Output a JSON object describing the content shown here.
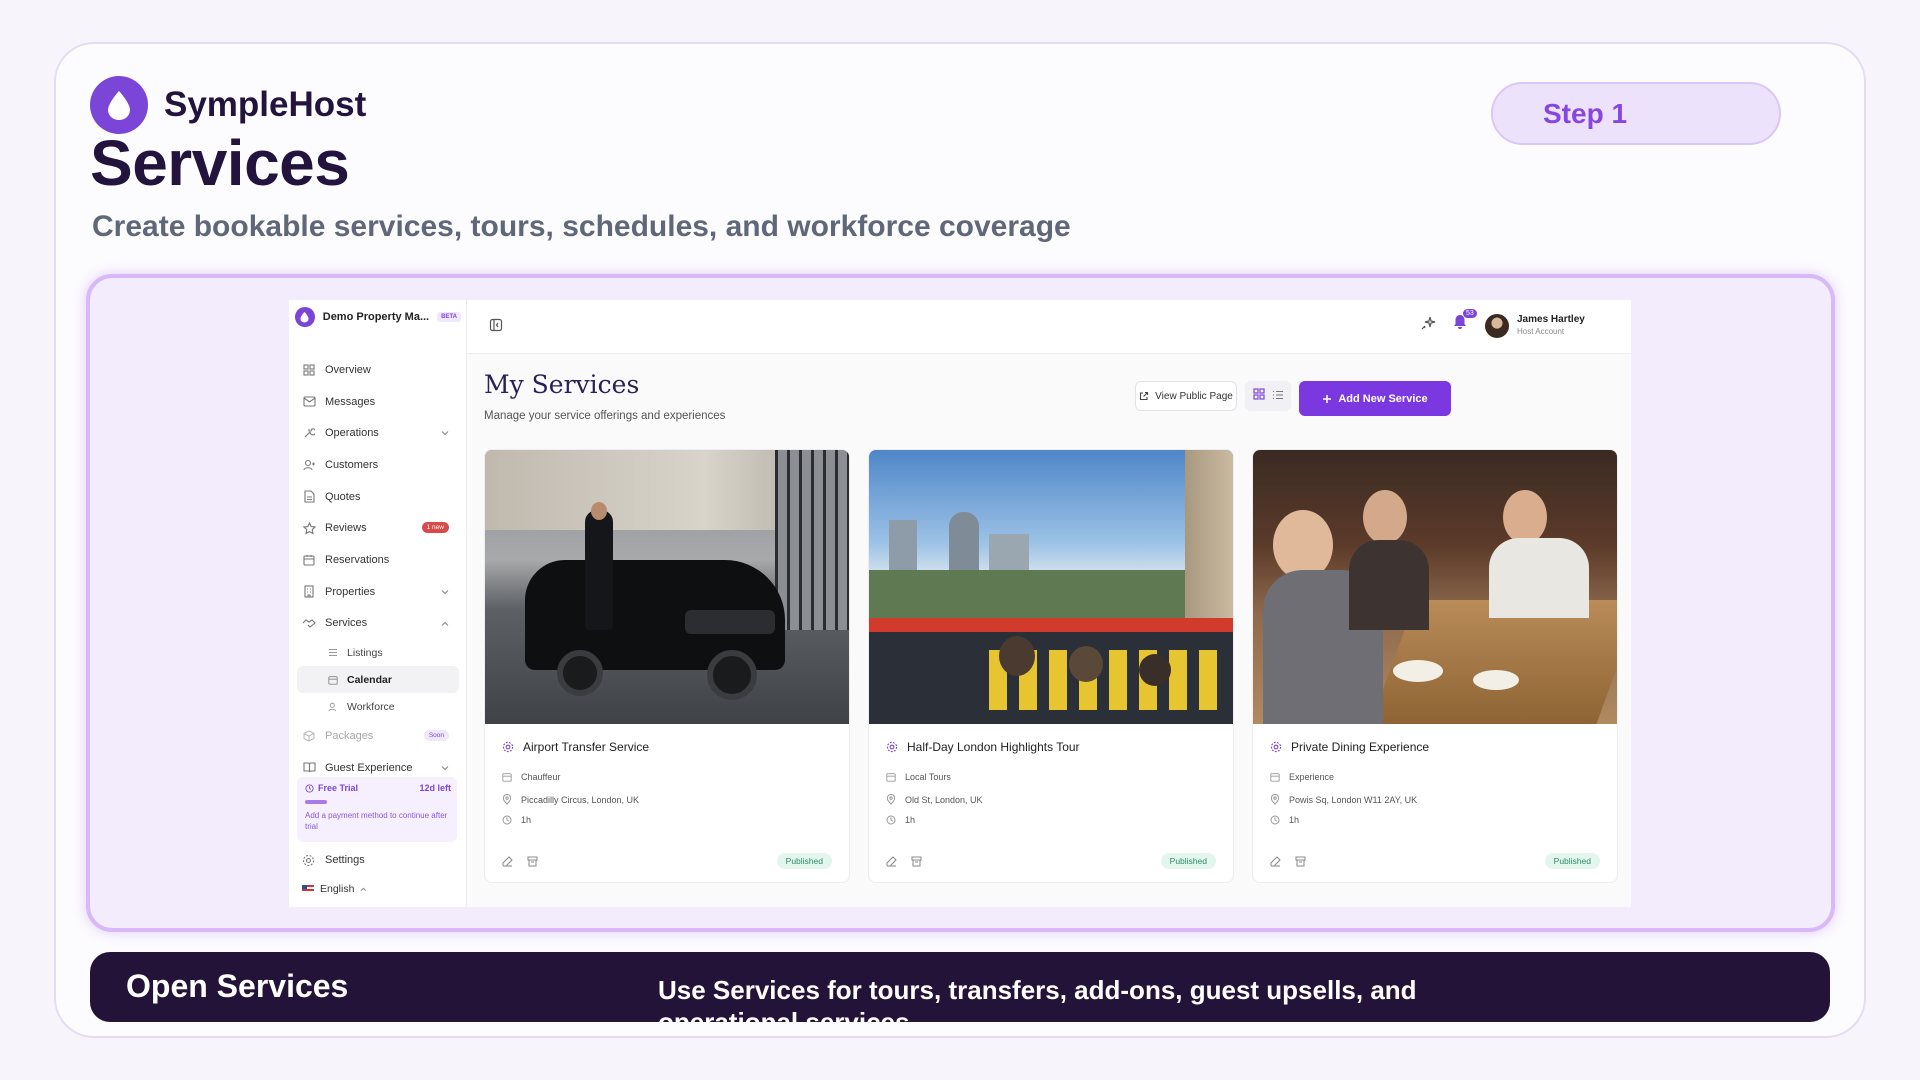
{
  "brand": {
    "name": "SympleHost",
    "color": "#7b45d8"
  },
  "header": {
    "title": "Services",
    "subtitle": "Create bookable services, tours, schedules, and workforce coverage",
    "step": "Step 1"
  },
  "sidebar": {
    "title": "Demo Property Ma...",
    "beta": "BETA",
    "items": [
      {
        "label": "Overview",
        "icon": "grid-icon"
      },
      {
        "label": "Messages",
        "icon": "mail-icon"
      },
      {
        "label": "Operations",
        "icon": "wrench-icon",
        "chevron": "down"
      },
      {
        "label": "Customers",
        "icon": "users-icon"
      },
      {
        "label": "Quotes",
        "icon": "document-icon"
      },
      {
        "label": "Reviews",
        "icon": "star-icon",
        "badge": "1 new"
      },
      {
        "label": "Reservations",
        "icon": "calendar-icon"
      },
      {
        "label": "Properties",
        "icon": "building-icon",
        "chevron": "down"
      },
      {
        "label": "Services",
        "icon": "handshake-icon",
        "chevron": "up"
      }
    ],
    "sub_items": [
      {
        "label": "Listings",
        "icon": "list-icon"
      },
      {
        "label": "Calendar",
        "icon": "calendar-icon",
        "active": true
      },
      {
        "label": "Workforce",
        "icon": "users-icon"
      }
    ],
    "packages": {
      "label": "Packages",
      "badge": "Soon"
    },
    "guest_experience": {
      "label": "Guest Experience"
    },
    "trial": {
      "label": "Free Trial",
      "remaining": "12d left",
      "note": "Add a payment method to continue after trial",
      "progress": 0.15
    },
    "settings": "Settings",
    "language": "English"
  },
  "topbar": {
    "notifications": "53",
    "user_name": "James Hartley",
    "user_role": "Host Account"
  },
  "main": {
    "title": "My Services",
    "subtitle": "Manage your service offerings and experiences",
    "view_public": "View Public Page",
    "add_new": "Add New Service",
    "accent": "#7b37e0"
  },
  "cards": [
    {
      "title": "Airport Transfer Service",
      "category": "Chauffeur",
      "location": "Piccadilly Circus, London, UK",
      "duration": "1h",
      "status": "Published"
    },
    {
      "title": "Half-Day London Highlights Tour",
      "category": "Local Tours",
      "location": "Old St, London, UK",
      "duration": "1h",
      "status": "Published"
    },
    {
      "title": "Private Dining Experience",
      "category": "Experience",
      "location": "Powis Sq, London W11 2AY, UK",
      "duration": "1h",
      "status": "Published"
    }
  ],
  "footer": {
    "title": "Open Services",
    "description": "Use Services for tours, transfers, add-ons, guest upsells, and operational services."
  }
}
